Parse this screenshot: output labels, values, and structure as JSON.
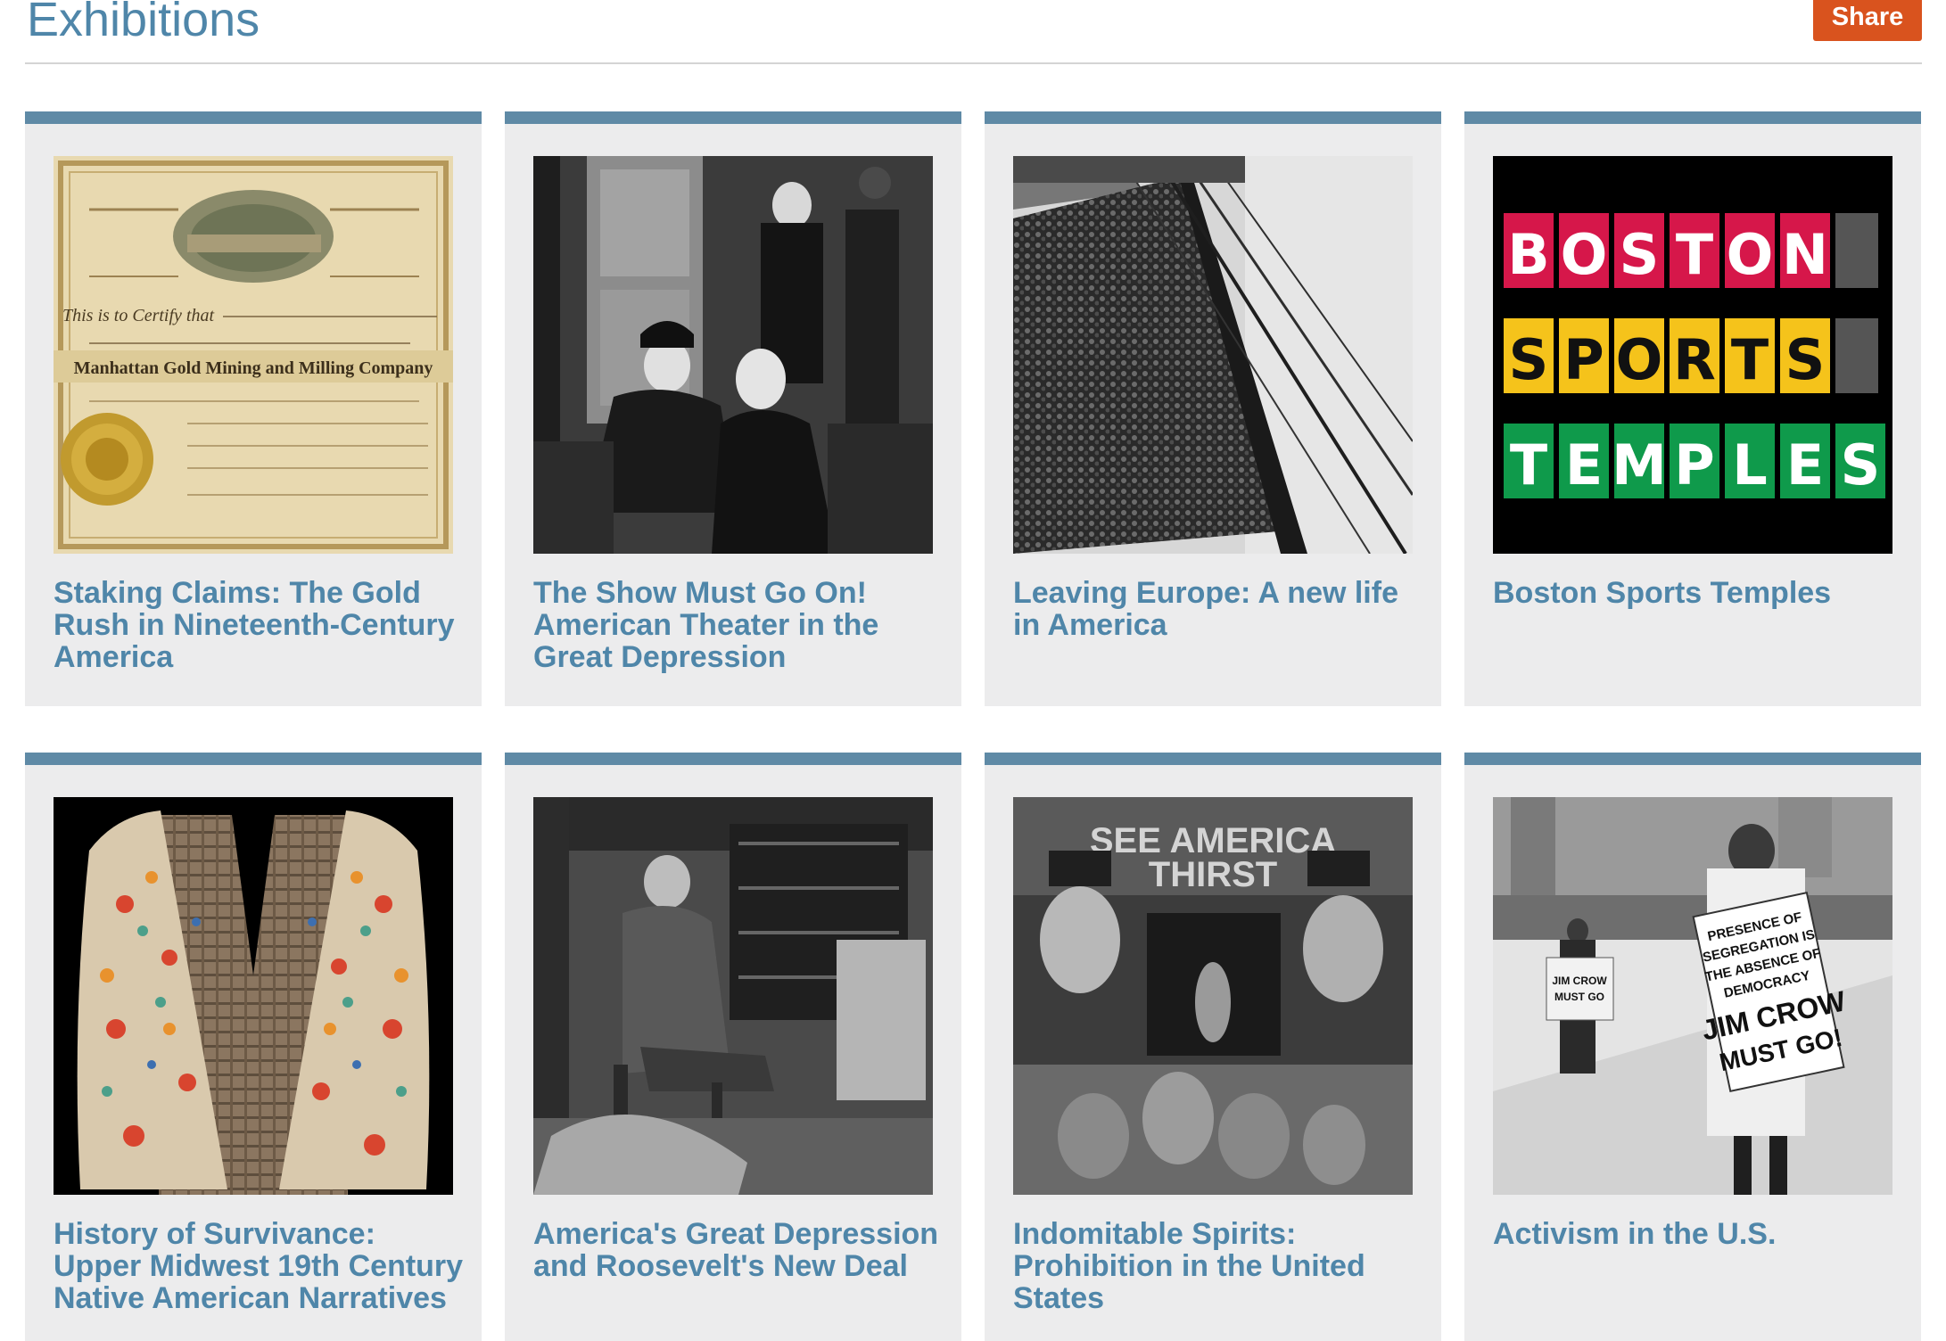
{
  "header": {
    "title": "Exhibitions",
    "share_label": "Share"
  },
  "exhibitions": [
    {
      "title": "Staking Claims: The Gold Rush in Nineteenth-Century America",
      "image": "gold-mining-stock-certificate"
    },
    {
      "title": "The Show Must Go On! American Theater in the Great Depression",
      "image": "theater-portrait-photo"
    },
    {
      "title": "Leaving Europe: A new life in America",
      "image": "immigrant-ship-photo"
    },
    {
      "title": "Boston Sports Temples",
      "image": "boston-sports-temples-logo"
    },
    {
      "title": "History of Survivance: Upper Midwest 19th Century Native American Narratives",
      "image": "beaded-vest-photo"
    },
    {
      "title": "America's Great Depression and Roosevelt's New Deal",
      "image": "roosevelt-fireside-photo"
    },
    {
      "title": "Indomitable Spirits: Prohibition in the United States",
      "image": "see-america-thirst-photo"
    },
    {
      "title": "Activism in the U.S.",
      "image": "jim-crow-protest-photo"
    }
  ],
  "image_text": {
    "certificate_company": "Manhattan Gold Mining and Milling Company",
    "certificate_certify": "This is to Certify that",
    "logo_line1": [
      "B",
      "O",
      "S",
      "T",
      "O",
      "N"
    ],
    "logo_line2": [
      "S",
      "P",
      "O",
      "R",
      "T",
      "S"
    ],
    "logo_line3": [
      "T",
      "E",
      "M",
      "P",
      "L",
      "E",
      "S"
    ],
    "marquee": "SEE AMERICA THIRST",
    "protest_sign_small": "JIM CROW MUST GO",
    "protest_sign_large": "PRESENCE OF SEGREGATION IS THE ABSENCE OF DEMOCRACY JIM CROW MUST GO!"
  },
  "colors": {
    "title_blue": "#4f86a9",
    "card_bar": "#5f8aa6",
    "card_bg": "#ececed",
    "share_orange": "#d9531e",
    "logo_red": "#d6174a",
    "logo_yellow": "#f5c31b",
    "logo_green": "#0f9a4b"
  }
}
